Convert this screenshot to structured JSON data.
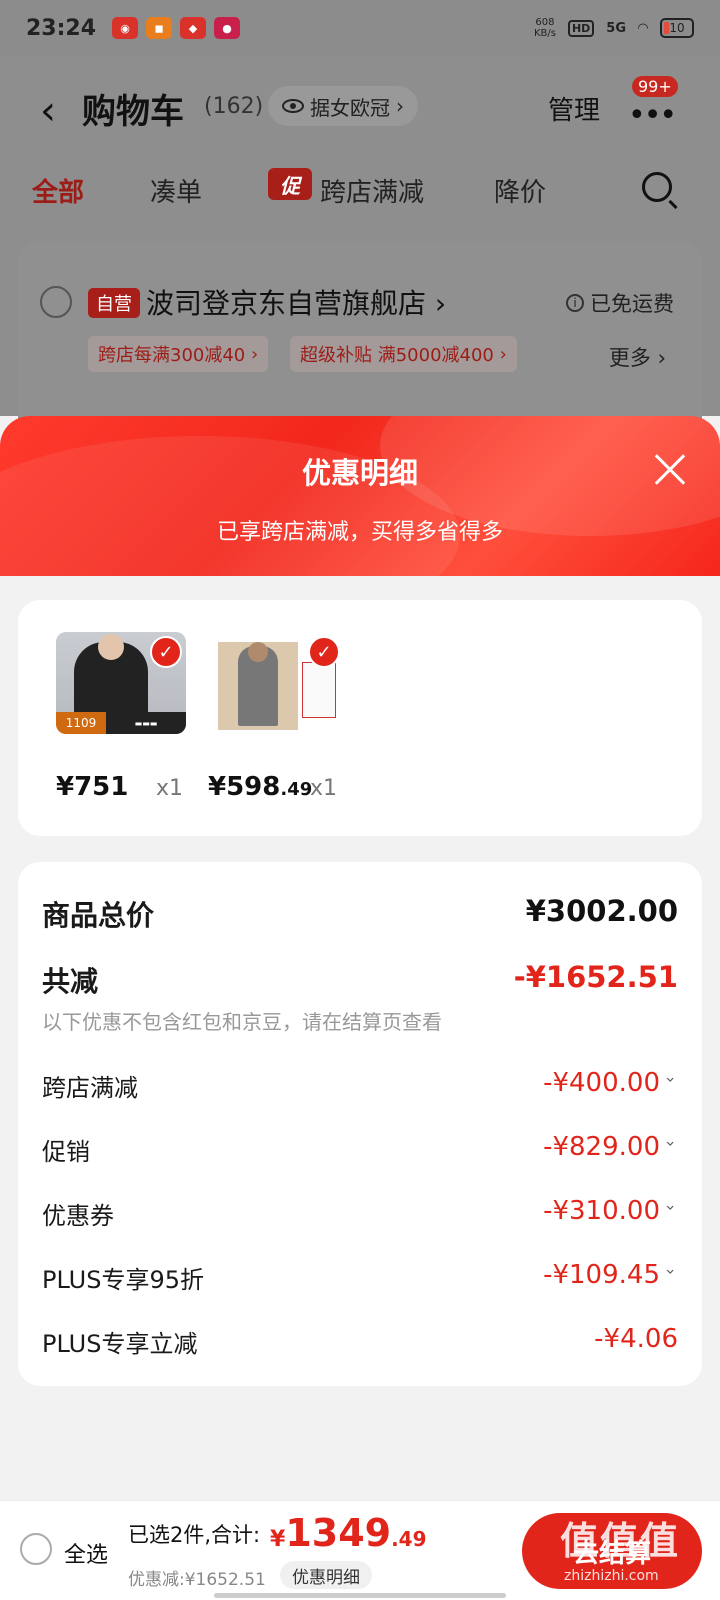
{
  "status_bar": {
    "time": "23:24",
    "net_speed_value": "608",
    "net_speed_unit": "KB/s",
    "hd": "HD",
    "network": "5G",
    "battery": "10"
  },
  "header": {
    "title": "购物车",
    "count": "(162)",
    "source_chip": "据女欧冠",
    "manage": "管理",
    "more_badge": "99+"
  },
  "filter_tabs": {
    "all": "全部",
    "combine": "凑单",
    "promo_tag": "促",
    "cross_store": "跨店满减",
    "price_drop": "降价"
  },
  "shop": {
    "self_tag": "自营",
    "name": "波司登京东自营旗舰店",
    "shipping": "已免运费",
    "promo1": "跨店每满300减40",
    "promo2": "超级补贴 满5000减400",
    "more": "更多"
  },
  "sheet": {
    "title": "优惠明细",
    "subtitle": "已享跨店满减，买得多省得多"
  },
  "products": [
    {
      "price": "751",
      "price_cents": "",
      "qty": "x1",
      "tag_price": "1109"
    },
    {
      "price": "598",
      "price_cents": ".49",
      "qty": "x1",
      "tag_price": ""
    }
  ],
  "summary": {
    "goods_total_label": "商品总价",
    "goods_total_value": "¥3002.00",
    "reduction_label": "共减",
    "reduction_value": "-¥1652.51",
    "note": "以下优惠不包含红包和京豆，请在结算页查看",
    "items": [
      {
        "label": "跨店满减",
        "value": "-¥400.00",
        "expandable": true
      },
      {
        "label": "促销",
        "value": "-¥829.00",
        "expandable": true
      },
      {
        "label": "优惠券",
        "value": "-¥310.00",
        "expandable": true
      },
      {
        "label": "PLUS专享95折",
        "value": "-¥109.45",
        "expandable": true
      },
      {
        "label": "PLUS专享立减",
        "value": "-¥4.06",
        "expandable": false
      }
    ]
  },
  "bottom_bar": {
    "select_all": "全选",
    "selected_text": "已选2件,合计:",
    "currency": "¥",
    "total_int": "1349",
    "total_cents": ".49",
    "saved_text": "优惠减:¥1652.51",
    "detail_chip": "优惠明细",
    "checkout": "去结算"
  },
  "watermark": {
    "logo": "值值值",
    "url": "zhizhizhi.com"
  },
  "colors": {
    "accent": "#e1251b",
    "sheet_header": "#f2271c"
  }
}
